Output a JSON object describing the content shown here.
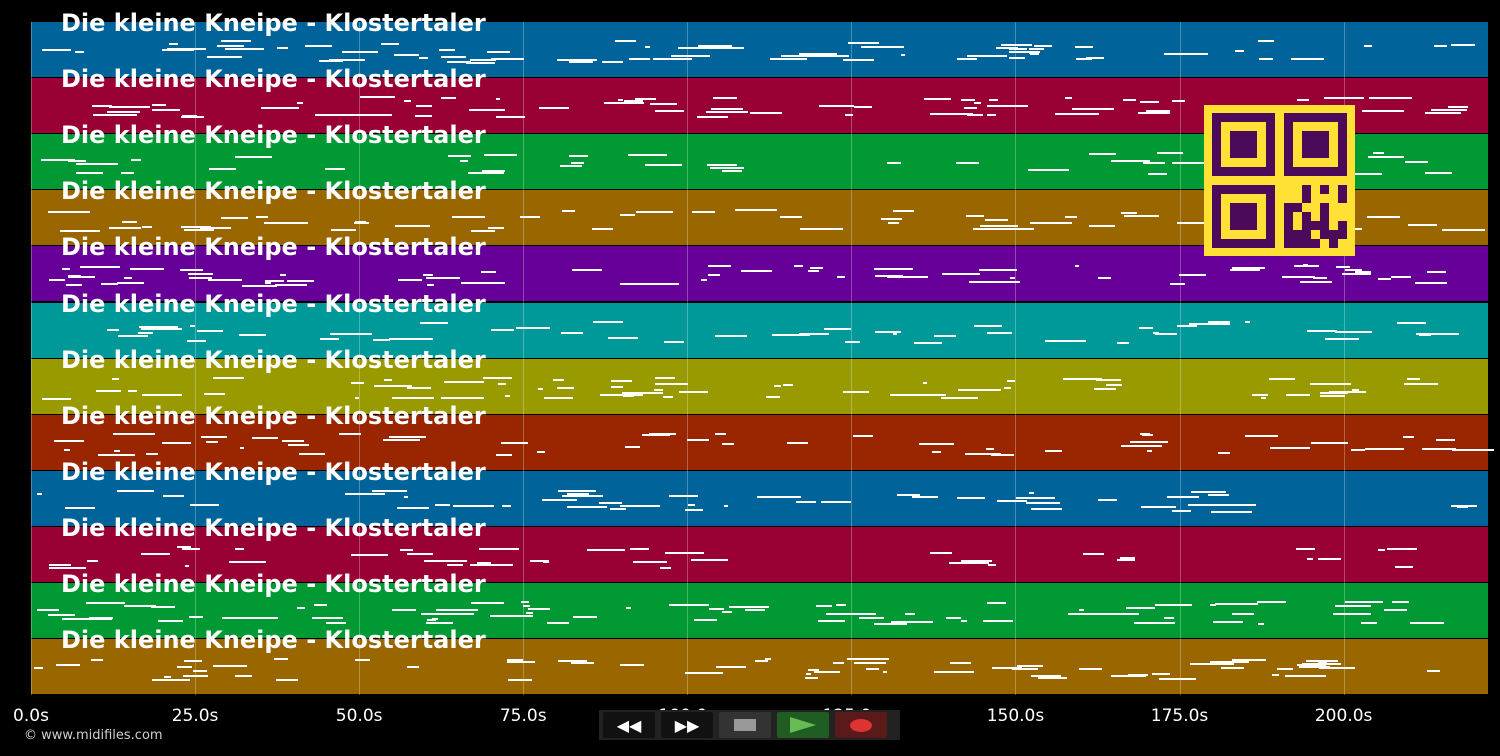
{
  "track_title": "Die kleine Kneipe - Klostertaler",
  "tracks": [
    {
      "color": "#006399"
    },
    {
      "color": "#990033"
    },
    {
      "color": "#009933"
    },
    {
      "color": "#996600"
    },
    {
      "color": "#660099"
    },
    {
      "color": "#009999"
    },
    {
      "color": "#999900"
    },
    {
      "color": "#992600"
    },
    {
      "color": "#006399"
    },
    {
      "color": "#990033"
    },
    {
      "color": "#009933"
    },
    {
      "color": "#996600"
    }
  ],
  "timeline": {
    "ticks": [
      "0.0s",
      "25.0s",
      "50.0s",
      "75.0s",
      "100.0s",
      "125.0s",
      "150.0s",
      "175.0s",
      "200.0s"
    ],
    "tick_seconds": [
      0,
      25,
      50,
      75,
      100,
      125,
      150,
      175,
      200
    ],
    "duration_seconds": 222
  },
  "controls": {
    "rewind_icon": "double-chevron-left-icon",
    "forward_icon": "double-chevron-right-icon",
    "stop_icon": "stop-icon",
    "play_icon": "play-icon",
    "record_icon": "record-icon"
  },
  "footer": {
    "copyright": "© www.midifiles.com"
  }
}
